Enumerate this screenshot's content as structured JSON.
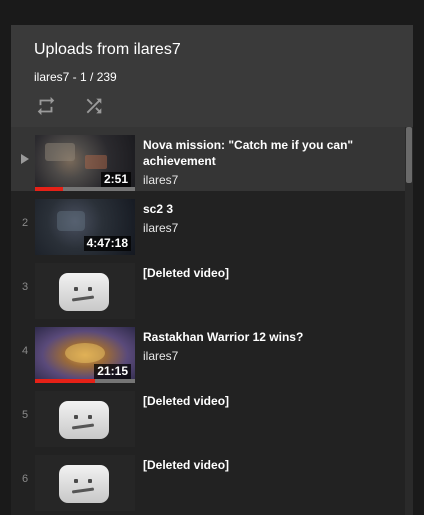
{
  "playlist": {
    "title": "Uploads from ilares7",
    "subtitle": "ilares7 - 1 / 239",
    "loop_icon": "loop-icon",
    "shuffle_icon": "shuffle-icon"
  },
  "items": [
    {
      "index": "1",
      "title": "Nova mission: \"Catch me if you can\" achievement",
      "owner": "ilares7",
      "duration": "2:51",
      "progress": 0.28,
      "deleted": false
    },
    {
      "index": "2",
      "title": "sc2 3",
      "owner": "ilares7",
      "duration": "4:47:18",
      "deleted": false
    },
    {
      "index": "3",
      "title": "[Deleted video]",
      "deleted": true
    },
    {
      "index": "4",
      "title": "Rastakhan Warrior 12 wins?",
      "owner": "ilares7",
      "duration": "21:15",
      "progress": 0.6,
      "deleted": false
    },
    {
      "index": "5",
      "title": "[Deleted video]",
      "deleted": true
    },
    {
      "index": "6",
      "title": "[Deleted video]",
      "deleted": true
    }
  ],
  "colors": {
    "header_bg": "#3a3a3a",
    "panel_bg": "#222222",
    "progress": "#e62117"
  }
}
